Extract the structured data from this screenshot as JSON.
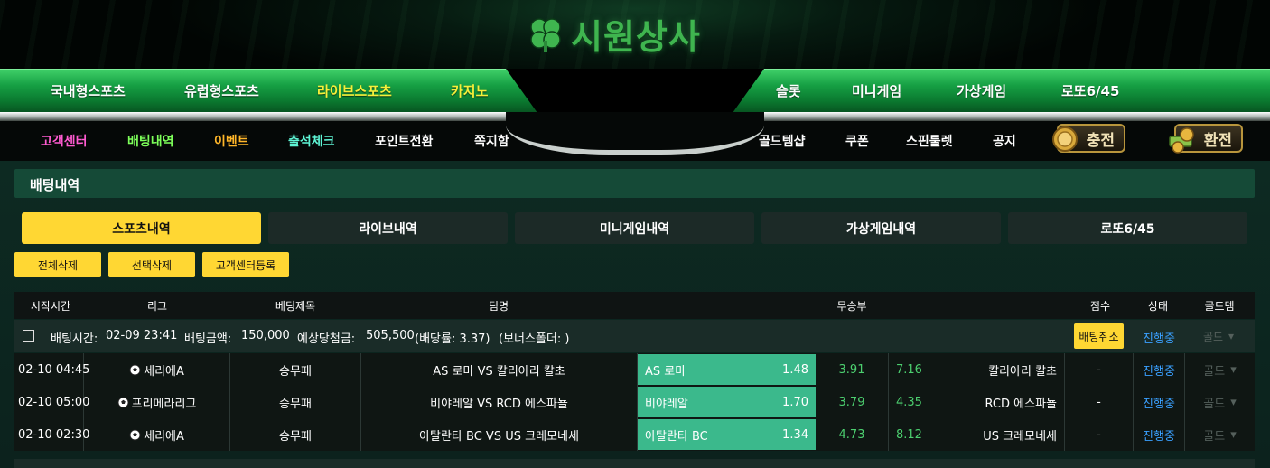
{
  "site": {
    "logo_text": "시원상사"
  },
  "main_nav": {
    "left": [
      {
        "label": "국내형스포츠",
        "color": "#ffffff"
      },
      {
        "label": "유럽형스포츠",
        "color": "#ffffff"
      },
      {
        "label": "라이브스포츠",
        "color": "#f5ef3a"
      },
      {
        "label": "카지노",
        "color": "#f5ef3a"
      }
    ],
    "right": [
      {
        "label": "슬롯",
        "color": "#ffffff"
      },
      {
        "label": "미니게임",
        "color": "#ffffff"
      },
      {
        "label": "가상게임",
        "color": "#ffffff"
      },
      {
        "label": "로또6/45",
        "color": "#ffffff"
      }
    ]
  },
  "sub_nav": {
    "left": [
      {
        "label": "고객센터",
        "color": "#ff5bd0"
      },
      {
        "label": "배팅내역",
        "color": "#7dff5a"
      },
      {
        "label": "이벤트",
        "color": "#ffb629"
      },
      {
        "label": "출석체크",
        "color": "#5ef5d5"
      },
      {
        "label": "포인트전환",
        "color": "#ffffff"
      },
      {
        "label": "쪽지함",
        "color": "#ffffff"
      }
    ],
    "right": [
      {
        "label": "골드템샵",
        "color": "#ffffff"
      },
      {
        "label": "쿠폰",
        "color": "#ffffff"
      },
      {
        "label": "스핀룰렛",
        "color": "#ffffff"
      },
      {
        "label": "공지",
        "color": "#ffffff"
      }
    ],
    "charge_label": "충전",
    "exchange_label": "환전"
  },
  "page_title": "배팅내역",
  "tabs": [
    {
      "label": "스포츠내역",
      "active": true
    },
    {
      "label": "라이브내역",
      "active": false
    },
    {
      "label": "미니게임내역",
      "active": false
    },
    {
      "label": "가상게임내역",
      "active": false
    },
    {
      "label": "로또6/45",
      "active": false
    }
  ],
  "actions": {
    "delete_all": "전체삭제",
    "delete_selected": "선택삭제",
    "register_cs": "고객센터등록"
  },
  "table": {
    "headers": {
      "start_time": "시작시간",
      "league": "리그",
      "bet_title": "베팅제목",
      "team_name": "팀명",
      "result": "무승부",
      "score": "점수",
      "status": "상태",
      "gold_item": "골드템"
    },
    "bet_summary": {
      "bet_time_label": "배팅시간:",
      "bet_time": "02-09 23:41",
      "amount_label": "배팅금액:",
      "amount": "150,000",
      "expected_label": "예상당첨금:",
      "expected": "505,500",
      "odds_text": "(배당률: 3.37)",
      "bonus_text": "(보너스폴더: )",
      "cancel_label": "배팅취소",
      "status": "진행중",
      "gold": "골드"
    },
    "rows": [
      {
        "time": "02-10 04:45",
        "league": "세리에A",
        "title": "승무패",
        "match": "AS 로마 VS 칼리아리 칼초",
        "home": "AS 로마",
        "home_odds": "1.48",
        "draw_odds": "3.91",
        "away_odds": "7.16",
        "away": "칼리아리 칼초",
        "score": "-",
        "status": "진행중",
        "gold": "골드"
      },
      {
        "time": "02-10 05:00",
        "league": "프리메라리그",
        "title": "승무패",
        "match": "비야레알 VS RCD 에스파뇰",
        "home": "비야레알",
        "home_odds": "1.70",
        "draw_odds": "3.79",
        "away_odds": "4.35",
        "away": "RCD 에스파뇰",
        "score": "-",
        "status": "진행중",
        "gold": "골드"
      },
      {
        "time": "02-10 02:30",
        "league": "세리에A",
        "title": "승무패",
        "match": "아탈란타 BC VS US 크레모네세",
        "home": "아탈란타 BC",
        "home_odds": "1.34",
        "draw_odds": "4.73",
        "away_odds": "8.12",
        "away": "US 크레모네세",
        "score": "-",
        "status": "진행중",
        "gold": "골드"
      }
    ]
  },
  "colors": {
    "accent_yellow": "#ffd733",
    "selected_green": "#3bb98c",
    "status_blue": "#3aa0ff"
  }
}
